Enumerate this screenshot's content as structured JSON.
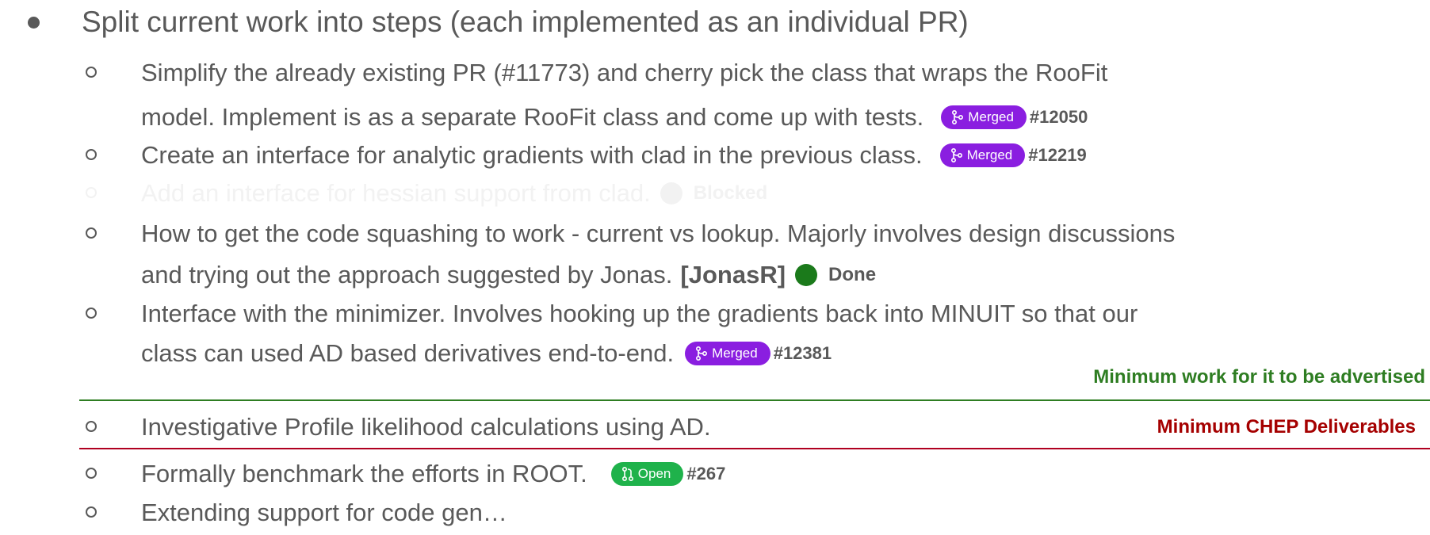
{
  "main_bullet": "Split current work into steps (each implemented as an individual PR)",
  "items": [
    {
      "line1": "Simplify the already existing PR (#11773) and cherry pick the class that wraps the RooFit",
      "line2": "model. Implement is as a separate RooFit class and come up with tests.",
      "badge": "Merged",
      "pr": "#12050"
    },
    {
      "line1": "Create an interface for analytic gradients with clad in the previous class.",
      "badge": "Merged",
      "pr": "#12219"
    },
    {
      "line1": "Add an interface for hessian support from clad.",
      "status": "Blocked"
    },
    {
      "line1": "How to get the code squashing to work - current vs lookup. Majorly involves design discussions",
      "line2": "and trying out the approach suggested by Jonas.",
      "tag": "[JonasR]",
      "status": "Done"
    },
    {
      "line1": "Interface with the minimizer. Involves hooking up the gradients back into MINUIT so that our",
      "line2": "class can used AD based derivatives end-to-end.",
      "badge": "Merged",
      "pr": "#12381"
    },
    {
      "line1": "Investigative Profile likelihood calculations using AD."
    },
    {
      "line1": "Formally benchmark the efforts in ROOT.",
      "badge": "Open",
      "pr": "#267"
    },
    {
      "line1": "Extending support for code gen…"
    }
  ],
  "annotations": {
    "advertised": "Minimum work for it to be advertised",
    "chep": "Minimum CHEP Deliverables"
  },
  "colors": {
    "text": "#595959",
    "merged": "#8a1ee0",
    "open": "#1fb24b",
    "done": "#1b7a1b",
    "green_rule": "#2e7d22",
    "red_rule": "#b00020",
    "red_text": "#a50000",
    "faded": "#f2f2f2"
  }
}
